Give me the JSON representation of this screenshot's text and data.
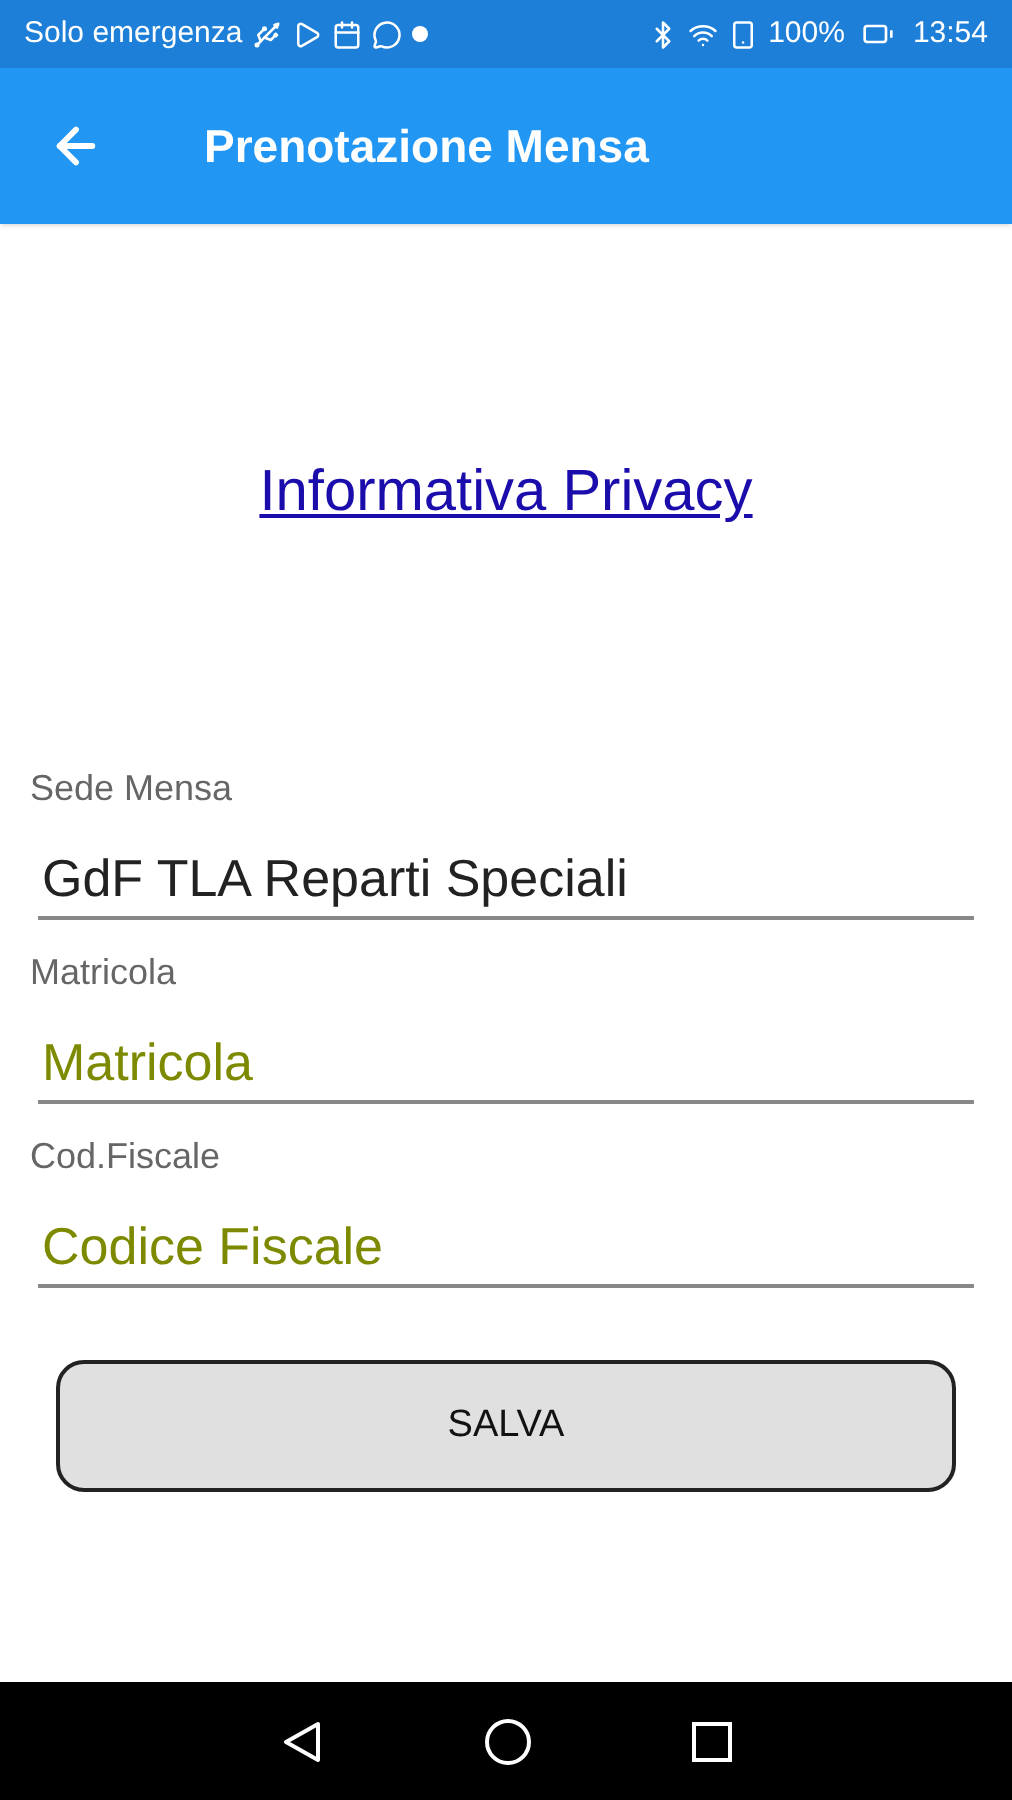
{
  "status_bar": {
    "carrier": "Solo emergenza",
    "battery": "100%",
    "time": "13:54"
  },
  "app_bar": {
    "title": "Prenotazione Mensa"
  },
  "privacy_link": "Informativa Privacy",
  "fields": [
    {
      "label": "Sede Mensa",
      "value": "GdF TLA Reparti Speciali"
    },
    {
      "label": "Matricola",
      "placeholder": "Matricola"
    },
    {
      "label": "Cod.Fiscale",
      "placeholder": "Codice Fiscale"
    }
  ],
  "save_button": "SALVA"
}
